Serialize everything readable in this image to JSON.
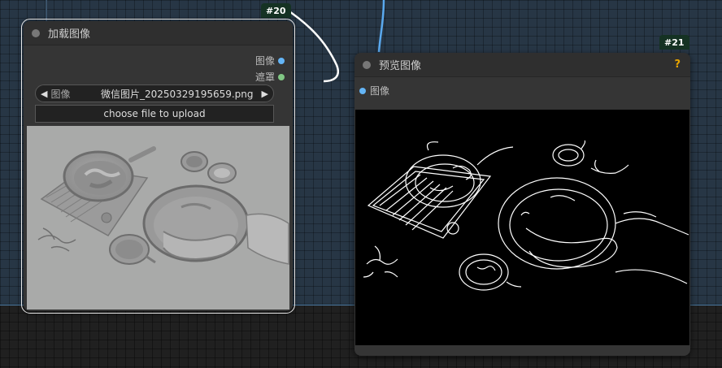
{
  "canvas": {
    "group_color": "#273645",
    "background_color": "#202020"
  },
  "load_node": {
    "badge": "#20",
    "title": "加载图像",
    "outputs": [
      {
        "label": "图像",
        "color": "#64b5f6"
      },
      {
        "label": "遮罩",
        "color": "#81c784"
      }
    ],
    "image_widget": {
      "label": "图像",
      "value": "微信图片_20250329195659.png",
      "prev_icon": "arrow-left-icon",
      "next_icon": "arrow-right-icon"
    },
    "upload_label": "choose file to upload",
    "preview": "grayscale-embossed-food-photo"
  },
  "preview_node": {
    "badge": "#21",
    "title": "预览图像",
    "help_icon_label": "?",
    "input": {
      "label": "图像",
      "color": "#64b5f6"
    },
    "preview": "canny-edge-food-photo"
  }
}
